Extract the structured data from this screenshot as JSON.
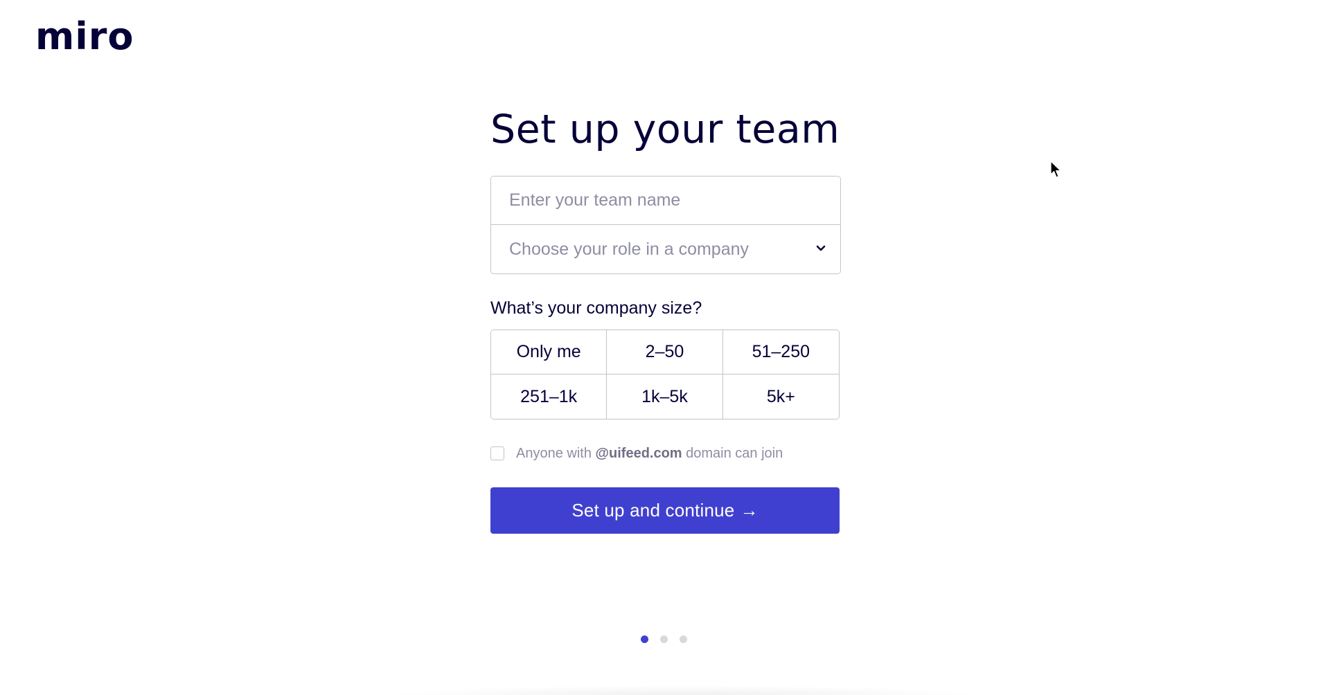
{
  "brand": {
    "logo_text": "miro",
    "accent_color": "#4040d0",
    "text_color": "#050038"
  },
  "form": {
    "title": "Set up your team",
    "team_name_placeholder": "Enter your team name",
    "role_placeholder": "Choose your role in a company",
    "size_question": "What’s your company size?",
    "size_options": [
      "Only me",
      "2–50",
      "51–250",
      "251–1k",
      "1k–5k",
      "5k+"
    ],
    "domain_join": {
      "prefix": "Anyone with ",
      "domain": "@uifeed.com",
      "suffix": " domain can join",
      "checked": false
    },
    "submit_label": "Set up and continue",
    "submit_arrow": "→"
  },
  "pagination": {
    "total": 3,
    "active_index": 0
  },
  "icons": {
    "role_dropdown": "chevron-down-icon",
    "cursor": "mouse-pointer-icon"
  }
}
